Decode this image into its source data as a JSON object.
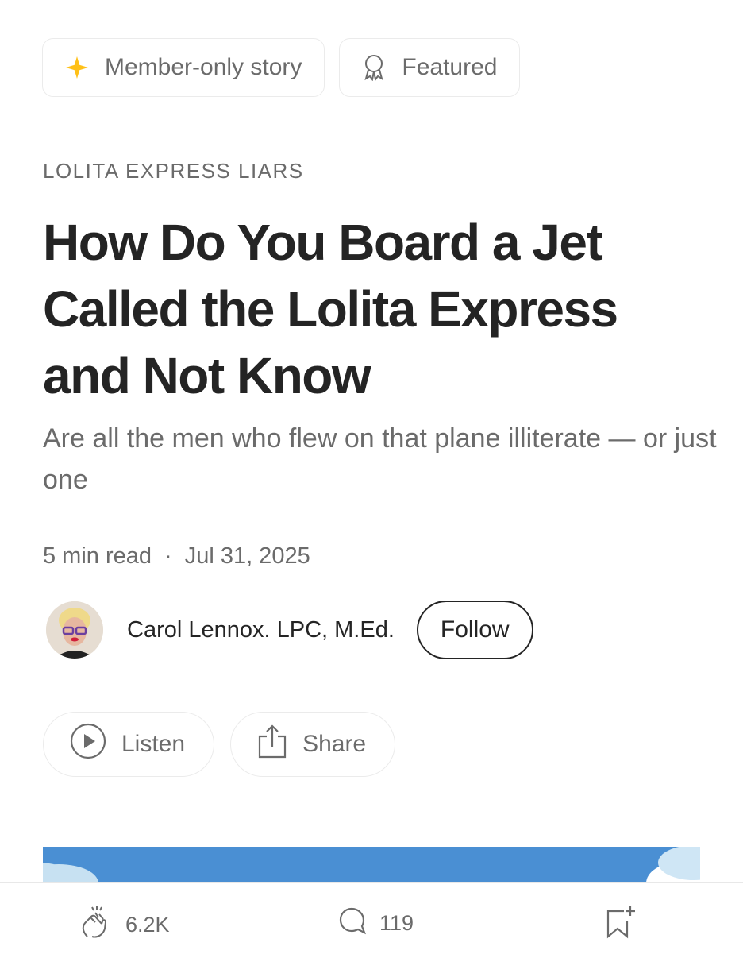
{
  "badges": {
    "member": {
      "label": "Member-only story",
      "icon": "sparkle-icon",
      "icon_color": "#ffc017"
    },
    "featured": {
      "label": "Featured",
      "icon": "award-ribbon-icon"
    }
  },
  "article": {
    "kicker": "LOLITA EXPRESS LIARS",
    "title": "How Do You Board a Jet Called the Lolita Express and Not Know",
    "subtitle": "Are all the men who flew on that plane illiterate — or just one",
    "read_time": "5 min read",
    "separator": "·",
    "date": "Jul 31, 2025"
  },
  "author": {
    "name": "Carol Lennox. LPC, M.Ed.",
    "follow_label": "Follow"
  },
  "actions": {
    "listen_label": "Listen",
    "share_label": "Share"
  },
  "bottom_bar": {
    "claps": "6.2K",
    "responses": "119"
  },
  "colors": {
    "text_primary": "#242424",
    "text_secondary": "#6b6b6b",
    "hero_blue": "#4a8fd3"
  }
}
